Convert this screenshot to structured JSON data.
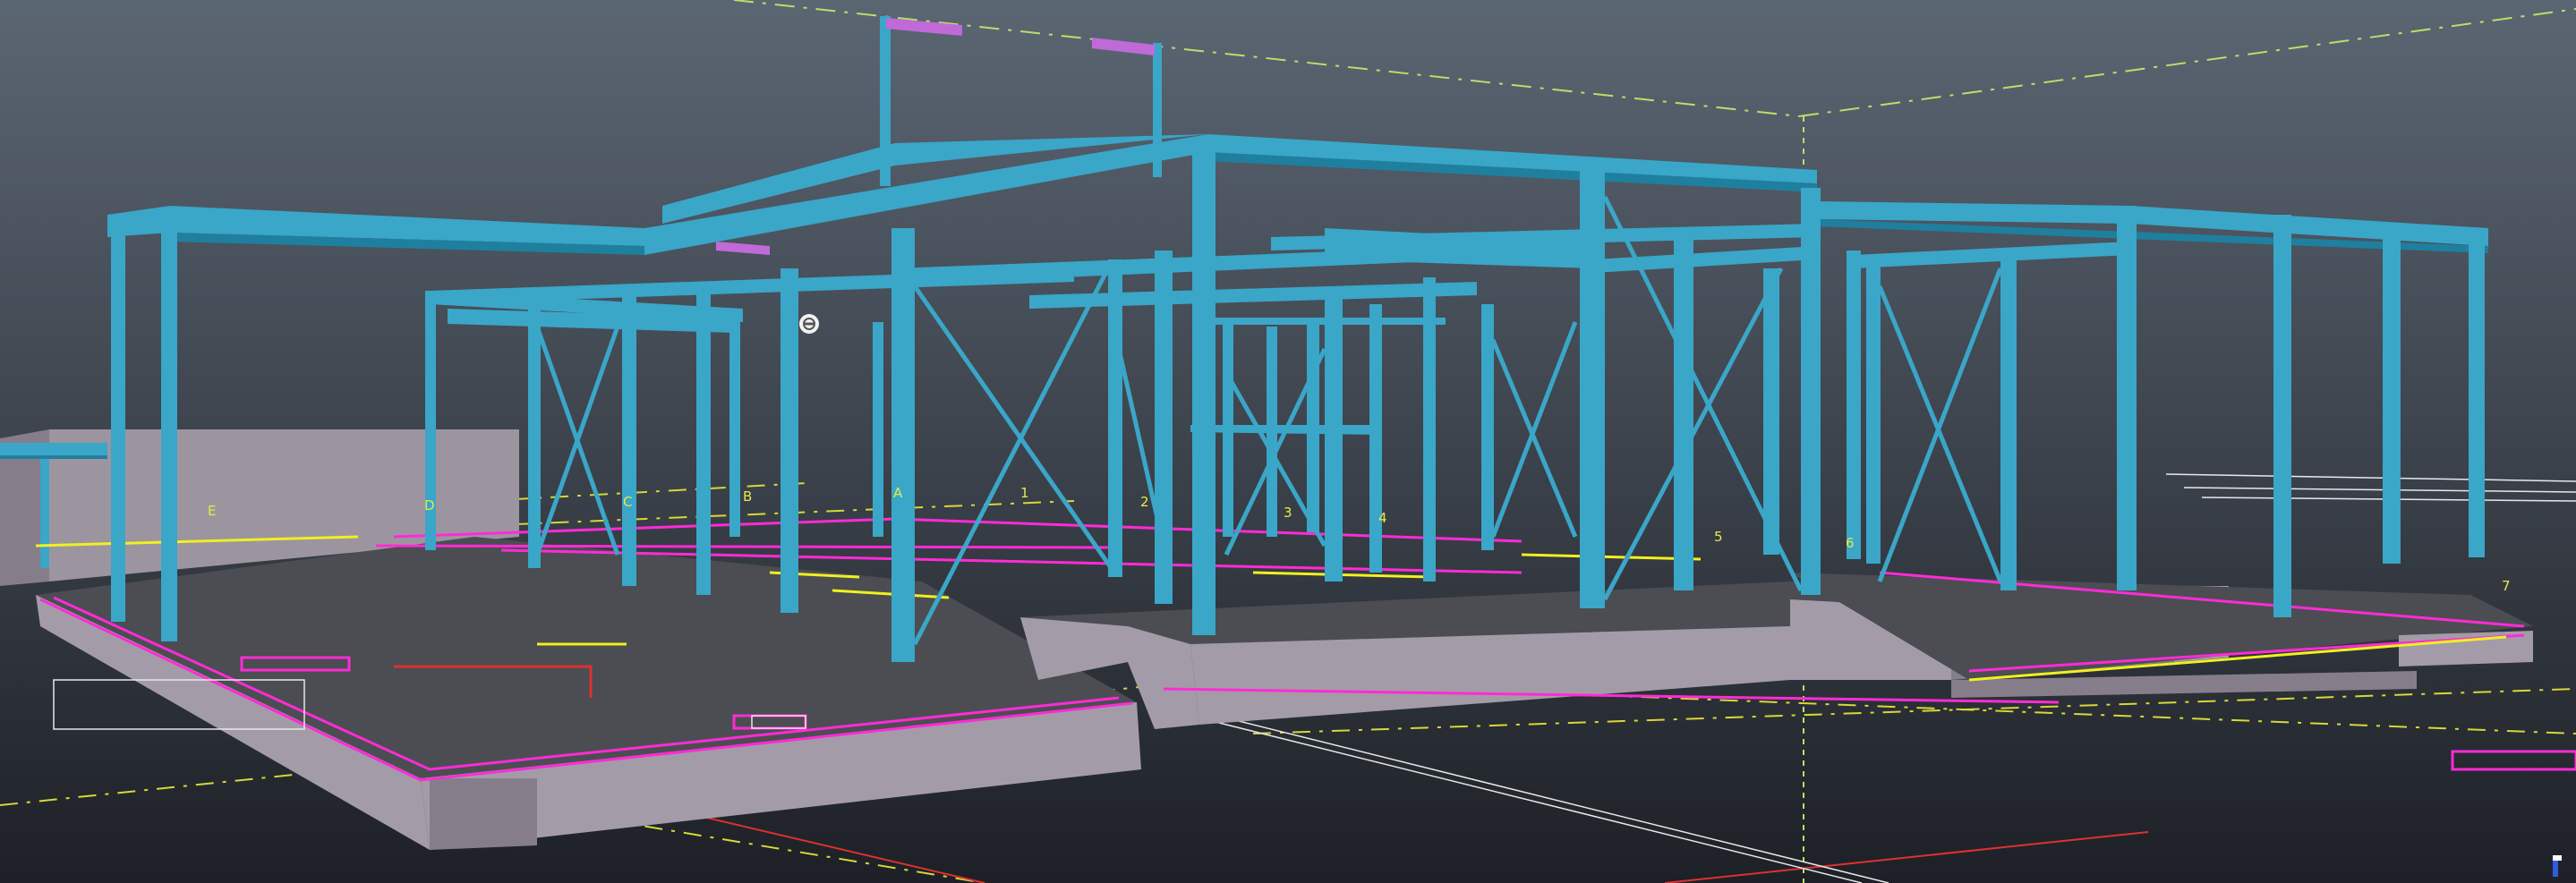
{
  "viewport": {
    "background_top": "#5b6673",
    "background_mid": "#3a4049",
    "background_bottom": "#1d2026"
  },
  "colors": {
    "steel": "#3aa6c8",
    "steel_dark": "#1f7f9e",
    "steel_light": "#62c3de",
    "concrete_top": "#4b4d52",
    "concrete_side": "#a39ca8",
    "concrete_side_dark": "#857e8a",
    "wall": "#9c95a0",
    "annotation_magenta": "#ff2bd6",
    "annotation_yellow": "#f0f020",
    "gridline_green": "#b8e06a",
    "gridline_yellow": "#d8d838",
    "gridline_red": "#e03030",
    "drawing_white": "#e8e8e8",
    "purple_marker": "#c06ad8"
  },
  "grid_labels": [
    "E",
    "D",
    "C",
    "B",
    "A",
    "1",
    "2",
    "3",
    "4",
    "5",
    "6",
    "7"
  ],
  "icons": {
    "orbit": "orbit-target-icon",
    "axis": "axis-triad-icon"
  }
}
